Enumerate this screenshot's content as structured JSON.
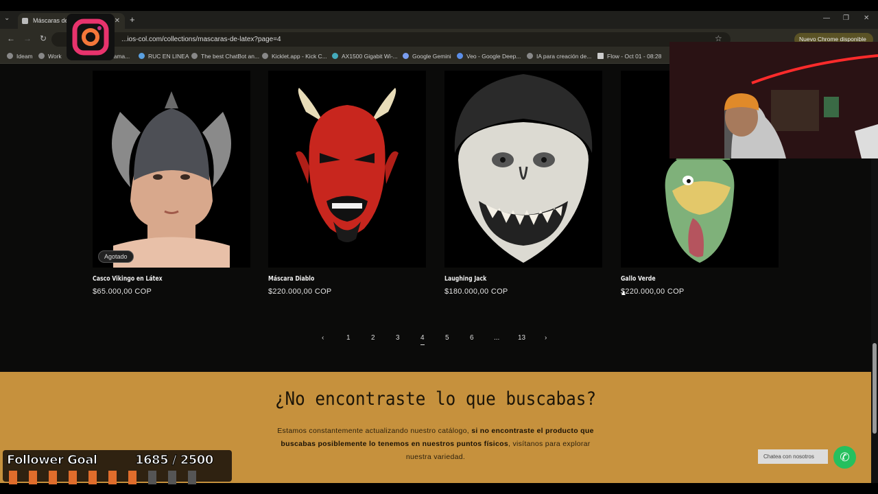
{
  "browser": {
    "tab_title": "Máscaras de l",
    "url": "...ios-col.com/collections/mascaras-de-latex?page=4",
    "update_label": "Nuevo Chrome disponible",
    "bookmarks": [
      "Ideam",
      "Work",
      "ize tama...",
      "RUC EN LINEA",
      "The best ChatBot an...",
      "Kicklet.app - Kick C...",
      "AX1500 Gigabit Wi-...",
      "Google Gemini",
      "Veo - Google Deep...",
      "IA para creación de...",
      "Flow - Oct 01 - 08:28"
    ]
  },
  "products": [
    {
      "name": "Casco Vikingo en Látex",
      "price": "$65.000,00 COP",
      "badge": "Agotado"
    },
    {
      "name": "Máscara Diablo",
      "price": "$220.000,00 COP"
    },
    {
      "name": "Laughing Jack",
      "price": "$180.000,00 COP"
    },
    {
      "name": "Gallo Verde",
      "price": "$220.000,00 COP"
    }
  ],
  "pagination": {
    "prev": "‹",
    "next": "›",
    "pages": [
      "1",
      "2",
      "3",
      "4",
      "5",
      "6",
      "...",
      "13"
    ],
    "current": "4"
  },
  "cta": {
    "title": "¿No encontraste lo que buscabas?",
    "text_1": "Estamos constantemente actualizando nuestro catálogo,",
    "text_bold_1": "si no encontraste el producto",
    "text_bold_2": "que buscabas posiblemente lo tenemos en nuestros puntos físicos",
    "text_2": ", visítanos para",
    "text_3": "explorar nuestra variedad."
  },
  "chat": {
    "label": "Chatea con nosotros",
    "icon": "whatsapp-icon"
  },
  "overlay": {
    "goal_label": "Follower Goal",
    "goal_count": "1685 / 2500",
    "goal_progress": 0.674,
    "colors": {
      "filled": "#e06d2c",
      "empty": "#555555",
      "accent": "#c6913d"
    }
  }
}
